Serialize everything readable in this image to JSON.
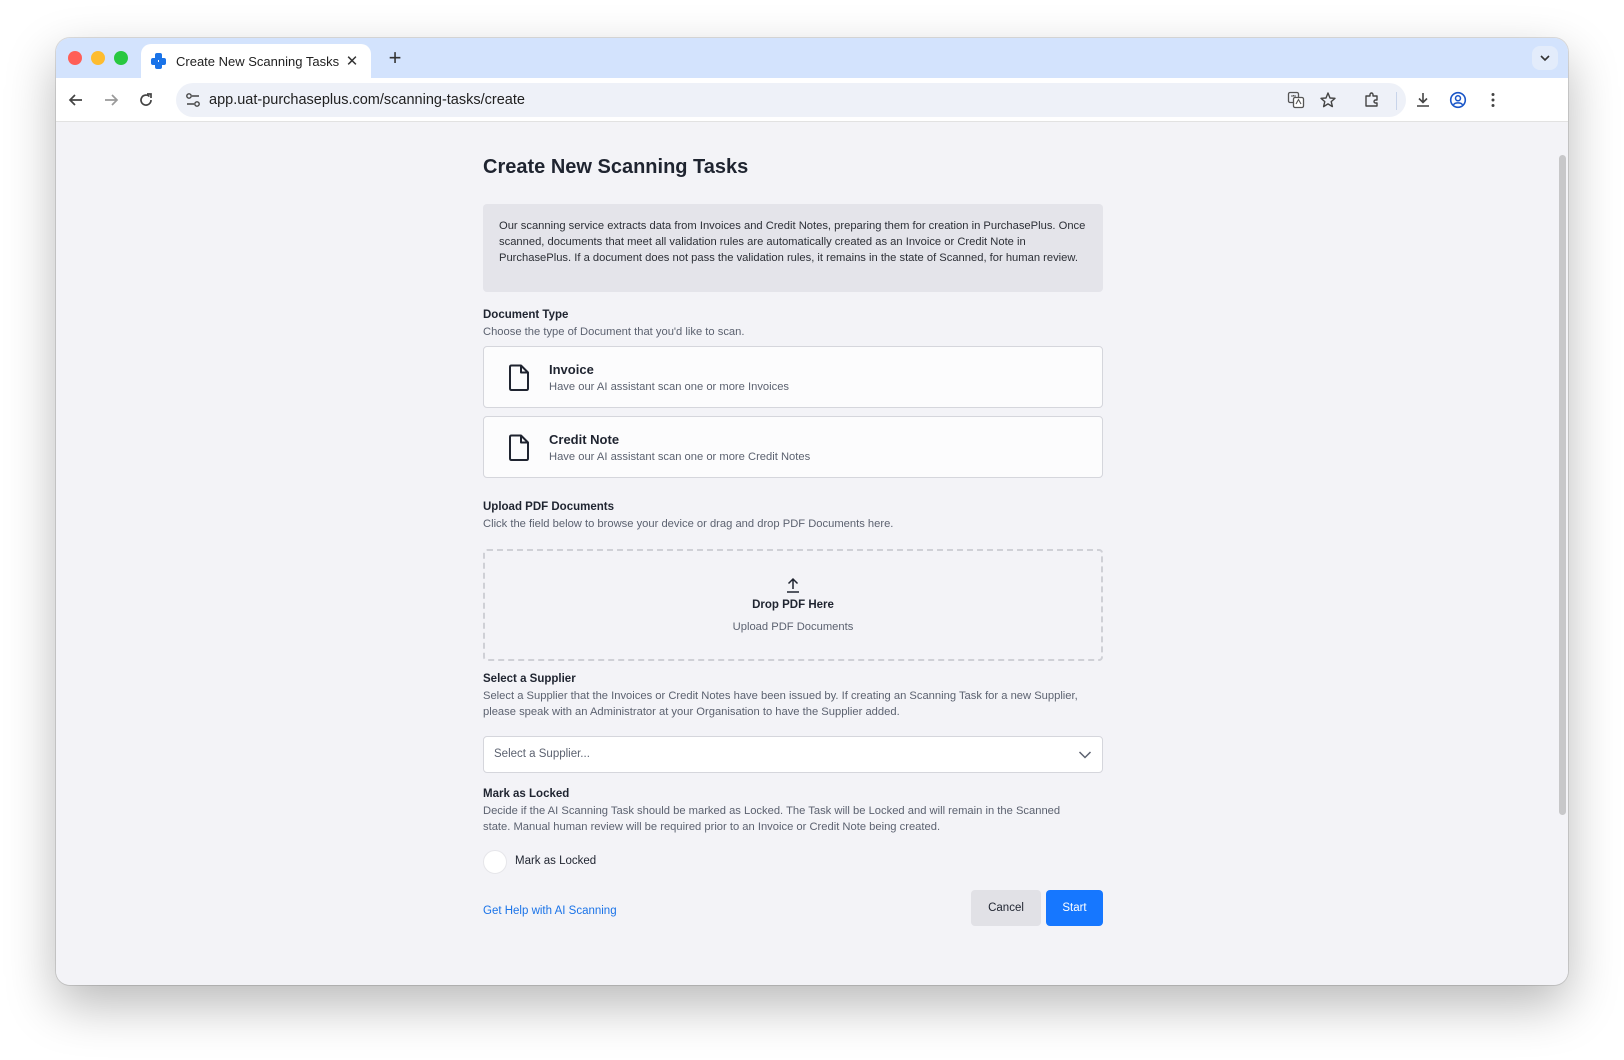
{
  "browser": {
    "tab_title": "Create New Scanning Tasks",
    "tab_close": "✕",
    "new_tab": "+",
    "url": "app.uat-purchaseplus.com/scanning-tasks/create"
  },
  "page": {
    "title": "Create New Scanning Tasks",
    "info_text": "Our scanning service extracts data from Invoices and Credit Notes, preparing them for creation in PurchasePlus. Once scanned, documents that meet all validation rules are automatically created as an Invoice or Credit Note in PurchasePlus. If a document does not pass the validation rules, it remains in the state of Scanned, for human review."
  },
  "document_type": {
    "title": "Document Type",
    "description": "Choose the type of Document that you'd like to scan.",
    "options": [
      {
        "title": "Invoice",
        "subtitle": "Have our AI assistant scan one or more Invoices"
      },
      {
        "title": "Credit Note",
        "subtitle": "Have our AI assistant scan one or more Credit Notes"
      }
    ]
  },
  "upload": {
    "title": "Upload PDF Documents",
    "description": "Click the field below to browse your device or drag and drop PDF Documents here.",
    "drop_title": "Drop PDF Here",
    "drop_subtitle": "Upload PDF Documents"
  },
  "supplier": {
    "title": "Select a Supplier",
    "description": "Select a Supplier that the Invoices or Credit Notes have been issued by. If creating an Scanning Task for a new Supplier, please speak with an Administrator at your Organisation to have the Supplier added.",
    "placeholder": "Select a Supplier..."
  },
  "locked": {
    "title": "Mark as Locked",
    "description": "Decide if the AI Scanning Task should be marked as Locked. The Task will be Locked and will remain in the Scanned state. Manual human review will be required prior to an Invoice or Credit Note being created.",
    "toggle_label": "Mark as Locked"
  },
  "footer": {
    "help_link": "Get Help with AI Scanning",
    "cancel_label": "Cancel",
    "start_label": "Start"
  },
  "colors": {
    "primary": "#1677ff",
    "link": "#1a73e8",
    "tabstrip": "#d3e3fd",
    "page_background": "#f3f3f7"
  }
}
